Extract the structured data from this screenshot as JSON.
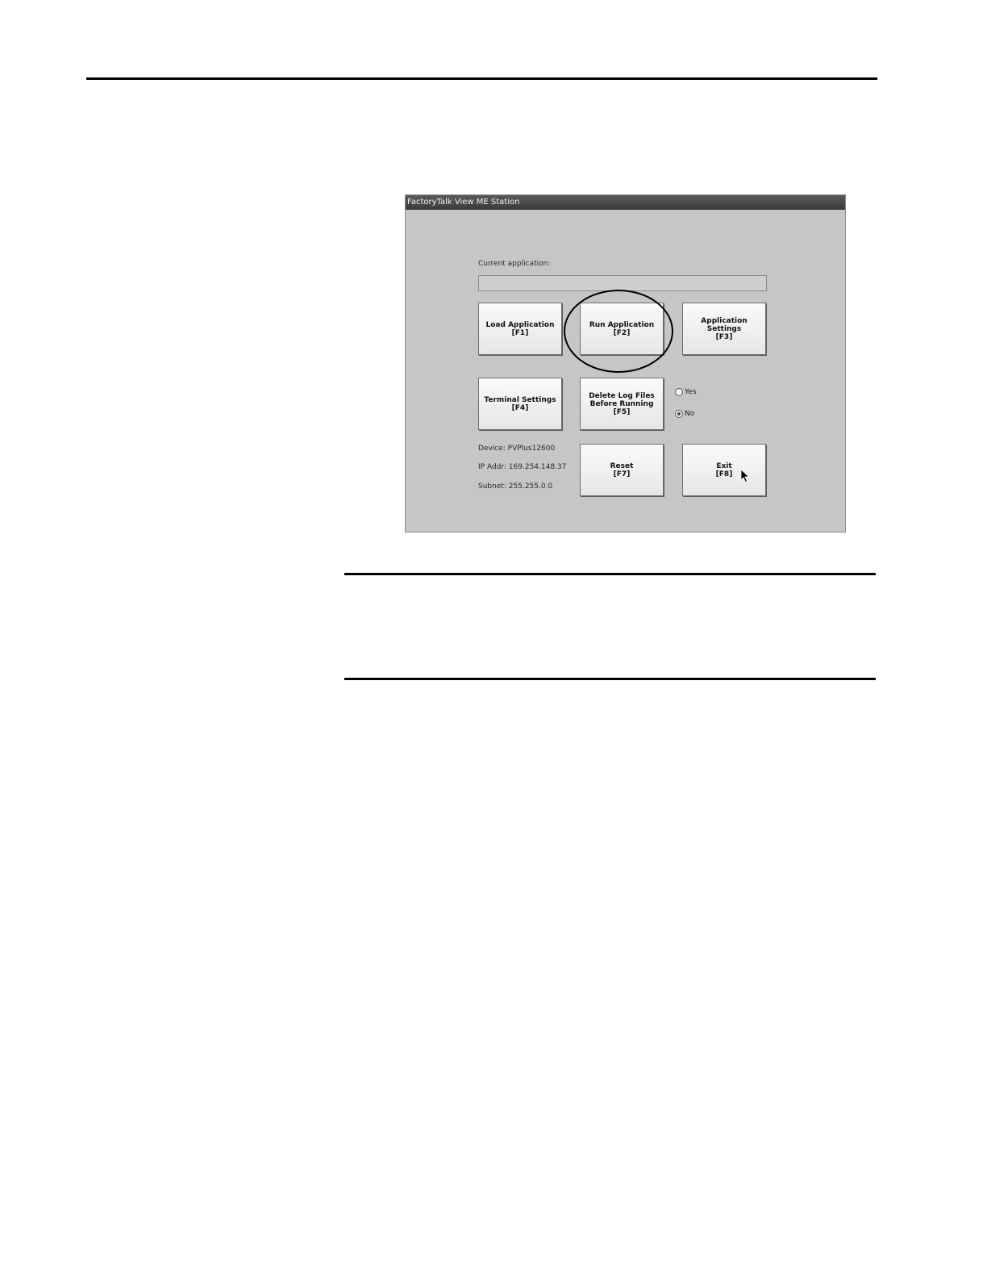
{
  "window": {
    "title": "FactoryTalk View ME Station"
  },
  "current_application": {
    "label": "Current application:",
    "value": ""
  },
  "buttons": {
    "load_application": {
      "line1": "Load Application",
      "line2": "[F1]"
    },
    "run_application": {
      "line1": "Run Application",
      "line2": "[F2]"
    },
    "application_settings": {
      "line1": "Application Settings",
      "line2": "[F3]"
    },
    "terminal_settings": {
      "line1": "Terminal Settings",
      "line2": "[F4]"
    },
    "delete_log_files": {
      "line1": "Delete Log Files",
      "line2": "Before Running",
      "line3": "[F5]"
    },
    "reset": {
      "line1": "Reset",
      "line2": "[F7]"
    },
    "exit": {
      "line1": "Exit",
      "line2": "[F8]"
    }
  },
  "delete_log_option": {
    "yes_label": "Yes",
    "no_label": "No",
    "selected": "No"
  },
  "device_info": {
    "device": "Device: PVPlus12600",
    "ip_addr": "IP Addr: 169.254.148.37",
    "subnet": "Subnet: 255.255.0.0"
  },
  "icons": {
    "cursor": "mouse-pointer-icon",
    "highlight": "highlight-ellipse"
  }
}
